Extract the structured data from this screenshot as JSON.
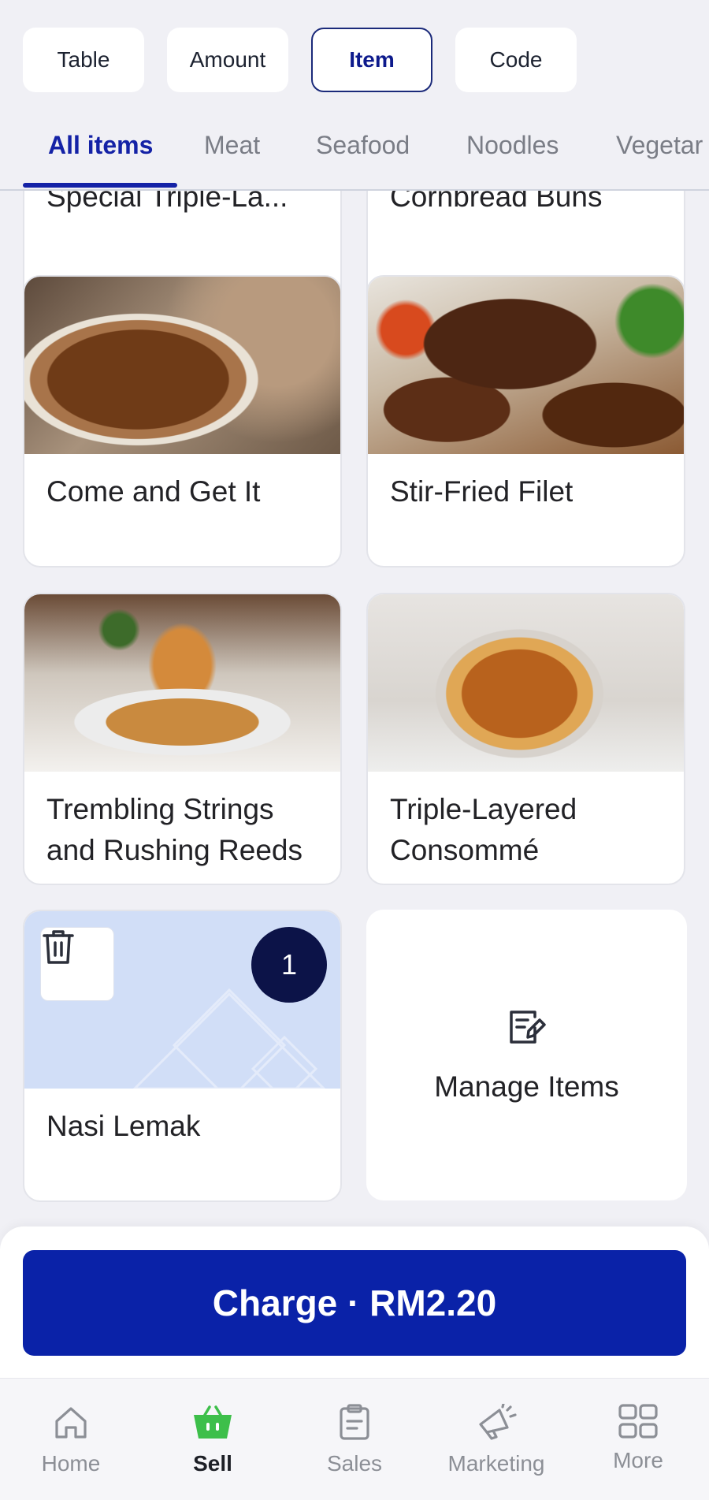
{
  "modes": {
    "table": "Table",
    "amount": "Amount",
    "item": "Item",
    "code": "Code",
    "active": "Item"
  },
  "tabs": {
    "all": "All items",
    "meat": "Meat",
    "seafood": "Seafood",
    "noodles": "Noodles",
    "vegetarian": "Vegetar",
    "active": "All items"
  },
  "items": {
    "special_triple": "Special Triple-La...",
    "cornbread": "Cornbread Buns",
    "come_get_it": "Come and Get It",
    "stir_fried_filet": "Stir-Fried Filet",
    "trembling_strings": "Trembling Strings and Rushing Reeds",
    "consomme": "Triple-Layered Consommé",
    "nasi_lemak": "Nasi Lemak",
    "nasi_lemak_qty": "1"
  },
  "manage": {
    "label": "Manage Items"
  },
  "charge": {
    "label": "Charge · RM2.20"
  },
  "nav": {
    "home": "Home",
    "sell": "Sell",
    "sales": "Sales",
    "marketing": "Marketing",
    "more": "More",
    "active": "Sell"
  },
  "colors": {
    "primary": "#0a22a8",
    "tab_active": "#1422a6",
    "badge": "#0c1348",
    "sell_icon": "#3dbf4a",
    "placeholder_bg": "#d1def7"
  }
}
